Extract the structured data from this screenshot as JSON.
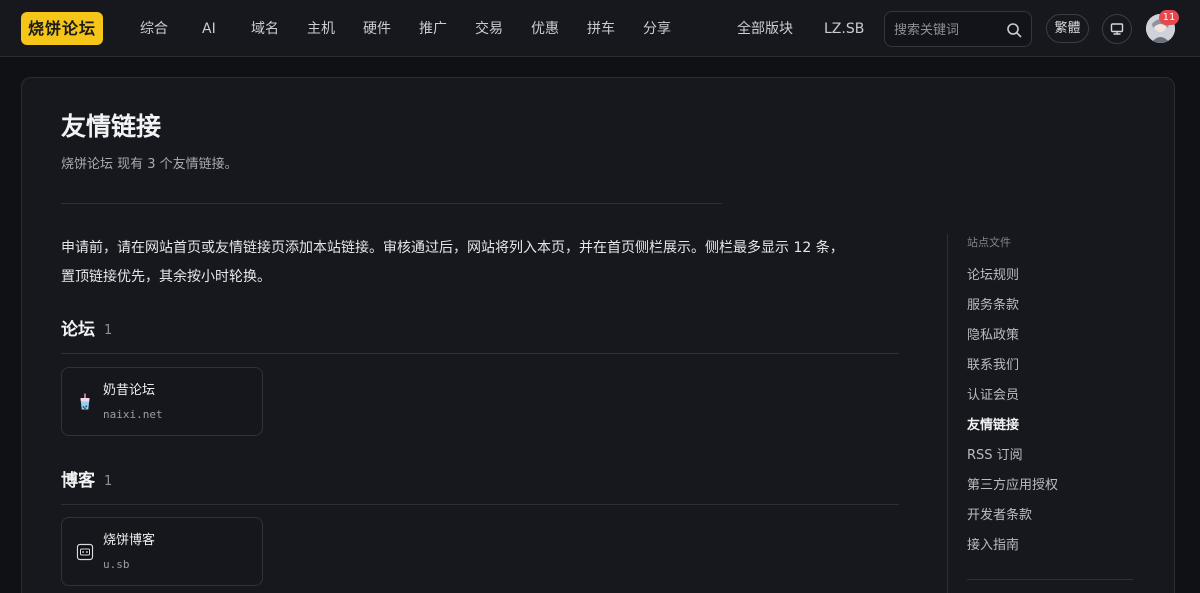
{
  "header": {
    "logo": "烧饼论坛",
    "nav": [
      "综合",
      "AI",
      "域名",
      "主机",
      "硬件",
      "推广",
      "交易",
      "优惠",
      "拼车",
      "分享"
    ],
    "right_links": [
      "全部版块",
      "LZ.SB"
    ],
    "search_placeholder": "搜索关键词",
    "lang_toggle": "繁體",
    "notification_count": "11",
    "icons": {
      "search": "search-icon",
      "display": "monitor-icon"
    }
  },
  "page": {
    "title": "友情链接",
    "subtitle": "烧饼论坛 现有 3 个友情链接。",
    "intro_line1": "申请前，请在网站首页或友情链接页添加本站链接。审核通过后，网站将列入本页，并在首页侧栏展示。侧栏最多显示 12 条，",
    "intro_line2": "置顶链接优先，其余按小时轮换。"
  },
  "sections": [
    {
      "title": "论坛",
      "count": "1",
      "links": [
        {
          "name": "奶昔论坛",
          "url": "naixi.net",
          "icon": "milk-tea-icon"
        }
      ]
    },
    {
      "title": "博客",
      "count": "1",
      "links": [
        {
          "name": "烧饼博客",
          "url": "u.sb",
          "icon": "sb-logo-icon"
        }
      ]
    }
  ],
  "sidebar": {
    "heading": "站点文件",
    "items": [
      "论坛规则",
      "服务条款",
      "隐私政策",
      "联系我们",
      "认证会员",
      "友情链接",
      "RSS 订阅",
      "第三方应用授权",
      "开发者条款",
      "接入指南"
    ],
    "active": "友情链接"
  },
  "colors": {
    "logo_bg": "#f5c518",
    "background": "#0f1115",
    "card": "#16181d",
    "badge": "#e5484d"
  }
}
